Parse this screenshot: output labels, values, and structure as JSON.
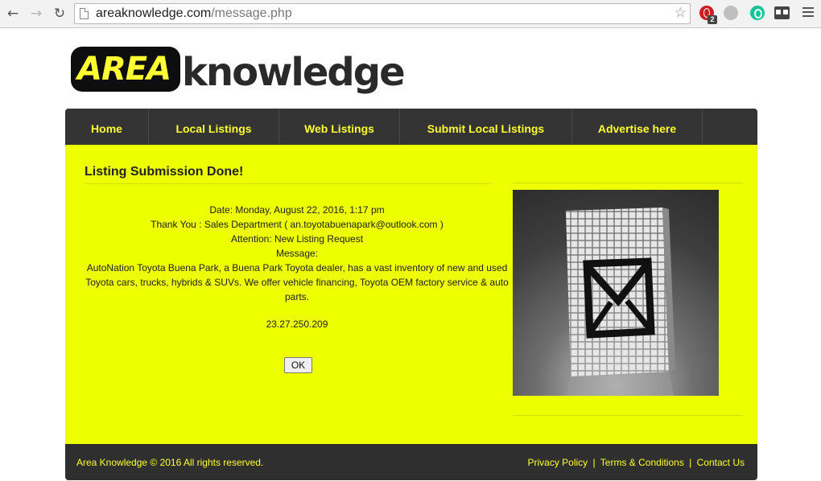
{
  "browser": {
    "url_host": "areaknowledge.com",
    "url_path": "/message.php",
    "extension_badge": "2"
  },
  "logo": {
    "area": "AREA",
    "knowledge": "knowledge"
  },
  "nav": {
    "items": [
      "Home",
      "Local Listings",
      "Web Listings",
      "Submit Local Listings",
      "Advertise here"
    ]
  },
  "main": {
    "heading": "Listing Submission Done!",
    "date_line": "Date: Monday, August 22, 2016, 1:17 pm",
    "thanks_line": "Thank You : Sales Department ( an.toyotabuenapark@outlook.com )",
    "attention_line": "Attention: New Listing Request",
    "message_label": "Message:",
    "message_body": "AutoNation Toyota Buena Park, a Buena Park Toyota dealer, has a vast inventory of new and used Toyota cars, trucks, hybrids & SUVs. We offer vehicle financing, Toyota OEM factory service & auto parts.",
    "ip": "23.27.250.209",
    "ok_label": "OK"
  },
  "footer": {
    "copyright": "Area Knowledge © 2016 All rights reserved.",
    "links": [
      "Privacy Policy",
      "Terms & Conditions",
      "Contact Us"
    ],
    "separator": "|"
  },
  "colors": {
    "accent": "#ffff33",
    "content_bg": "#eeff00",
    "nav_bg": "#343434"
  },
  "icons": [
    "back-arrow-icon",
    "forward-arrow-icon",
    "reload-icon",
    "page-icon",
    "star-icon",
    "opera-extension-icon",
    "cloud-extension-icon",
    "grammarly-extension-icon",
    "reader-extension-icon",
    "menu-icon",
    "envelope-icon"
  ]
}
